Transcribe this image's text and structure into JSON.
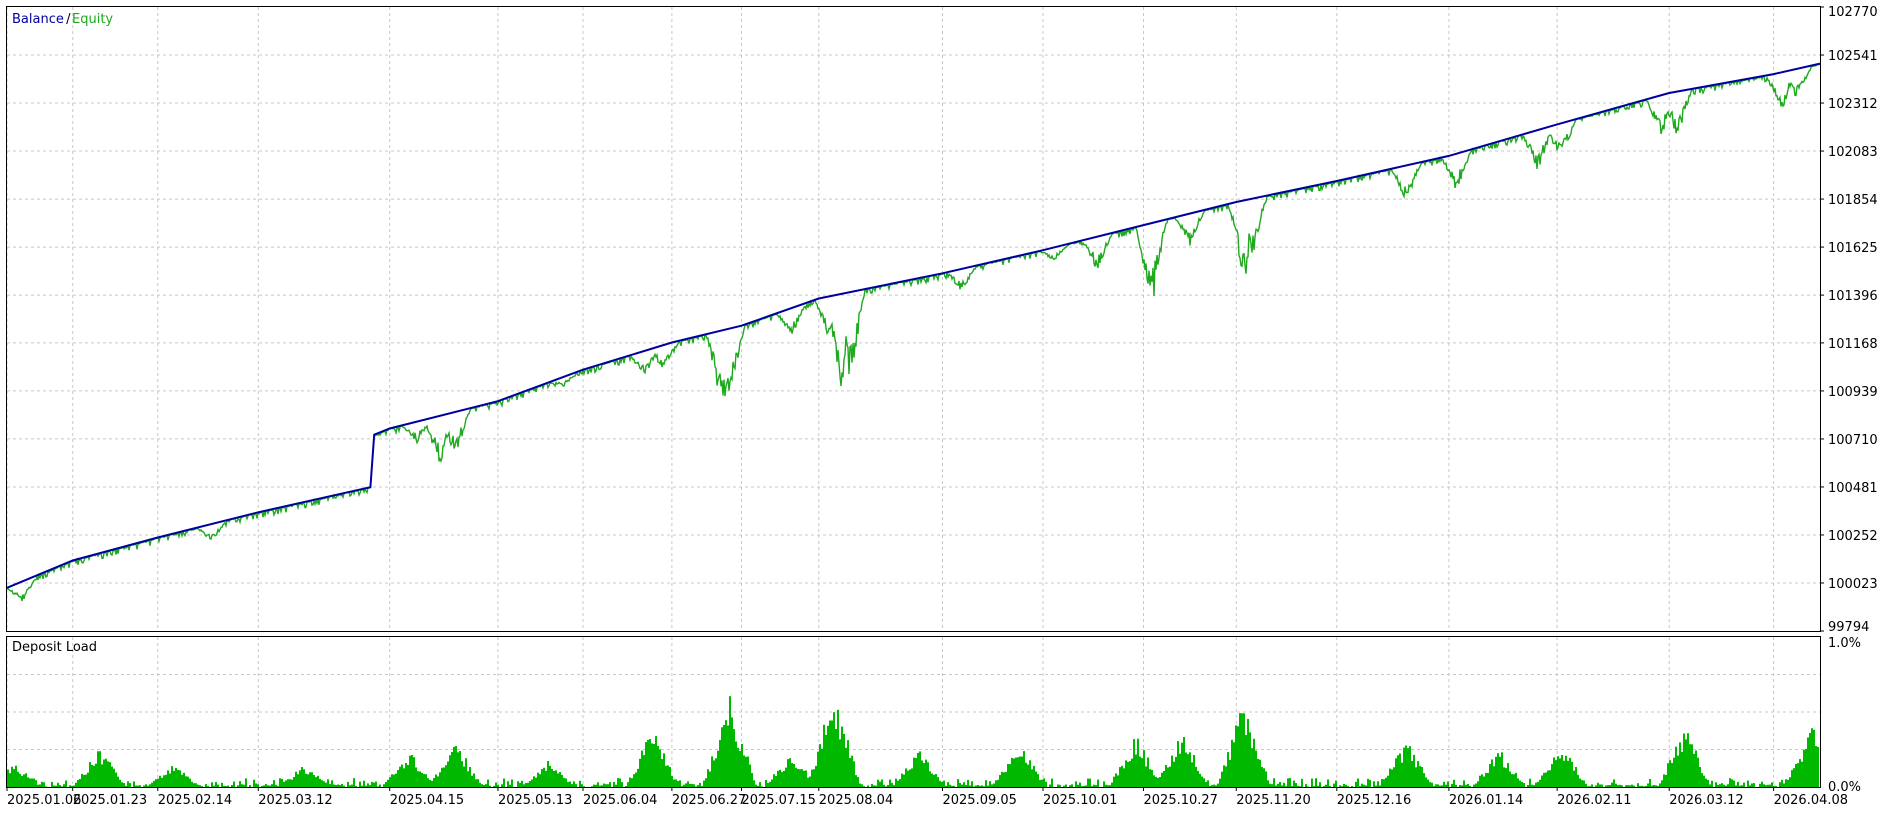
{
  "chart_data": [
    {
      "type": "line",
      "legend": [
        {
          "label": "Balance",
          "color": "#0000a0"
        },
        {
          "label": "Equity",
          "color": "#1fa91f"
        }
      ],
      "legend_separator": " / ",
      "legend_placement": "top-left",
      "grid": true,
      "ylim": [
        99794,
        102770
      ],
      "y_ticks": [
        102770,
        102541,
        102312,
        102083,
        101854,
        101625,
        101396,
        101168,
        100939,
        100710,
        100481,
        100252,
        100023,
        99794
      ],
      "x_ticks": [
        "2025.01.06",
        "2025.01.23",
        "2025.02.14",
        "2025.03.12",
        "2025.04.15",
        "2025.05.13",
        "2025.06.04",
        "2025.06.27",
        "2025.07.15",
        "2025.08.04",
        "2025.09.05",
        "2025.10.01",
        "2025.10.27",
        "2025.11.20",
        "2025.12.16",
        "2026.01.14",
        "2026.02.11",
        "2026.03.12",
        "2026.04.08"
      ],
      "series": [
        {
          "name": "Balance",
          "color": "#0000a0",
          "points": [
            [
              "2025.01.06",
              100000
            ],
            [
              "2025.01.23",
              100130
            ],
            [
              "2025.02.14",
              100240
            ],
            [
              "2025.03.12",
              100360
            ],
            [
              "2025.04.10",
              100480
            ],
            [
              "2025.04.11",
              100730
            ],
            [
              "2025.04.15",
              100760
            ],
            [
              "2025.05.13",
              100890
            ],
            [
              "2025.06.04",
              101040
            ],
            [
              "2025.06.27",
              101170
            ],
            [
              "2025.07.15",
              101250
            ],
            [
              "2025.08.04",
              101380
            ],
            [
              "2025.09.05",
              101500
            ],
            [
              "2025.10.01",
              101610
            ],
            [
              "2025.10.27",
              101730
            ],
            [
              "2025.11.20",
              101840
            ],
            [
              "2025.12.16",
              101940
            ],
            [
              "2026.01.14",
              102060
            ],
            [
              "2026.02.11",
              102210
            ],
            [
              "2026.03.12",
              102360
            ],
            [
              "2026.04.08",
              102450
            ],
            [
              "2026.04.20",
              102500
            ]
          ]
        },
        {
          "name": "Equity",
          "color": "#1fa91f",
          "dips": [
            [
              "2025.01.10",
              99920
            ],
            [
              "2025.02.28",
              100220
            ],
            [
              "2025.04.22",
              100690
            ],
            [
              "2025.04.28",
              100570
            ],
            [
              "2025.05.02",
              100620
            ],
            [
              "2025.05.30",
              100960
            ],
            [
              "2025.06.20",
              101010
            ],
            [
              "2025.06.25",
              101030
            ],
            [
              "2025.07.10",
              100830
            ],
            [
              "2025.07.12",
              100880
            ],
            [
              "2025.07.28",
              101200
            ],
            [
              "2025.08.07",
              101140
            ],
            [
              "2025.08.10",
              100900
            ],
            [
              "2025.08.12",
              100960
            ],
            [
              "2025.09.10",
              101410
            ],
            [
              "2025.10.04",
              101560
            ],
            [
              "2025.10.15",
              101510
            ],
            [
              "2025.10.29",
              101300
            ],
            [
              "2025.11.08",
              101630
            ],
            [
              "2025.11.22",
              101440
            ],
            [
              "2025.11.24",
              101560
            ],
            [
              "2026.01.03",
              101840
            ],
            [
              "2026.01.16",
              101890
            ],
            [
              "2026.02.06",
              101970
            ],
            [
              "2026.02.12",
              102040
            ],
            [
              "2026.03.10",
              102150
            ],
            [
              "2026.03.14",
              102140
            ],
            [
              "2026.04.10",
              102260
            ],
            [
              "2026.04.14",
              102330
            ]
          ]
        }
      ]
    },
    {
      "type": "area",
      "title": "Deposit Load",
      "ylim": [
        0,
        1.0
      ],
      "y_ticks": [
        "1.0%",
        "0.0%"
      ],
      "color": "#00b800",
      "x_ticks": [
        "2025.01.06",
        "2025.01.23",
        "2025.02.14",
        "2025.03.12",
        "2025.04.15",
        "2025.05.13",
        "2025.06.04",
        "2025.06.27",
        "2025.07.15",
        "2025.08.04",
        "2025.09.05",
        "2025.10.01",
        "2025.10.27",
        "2025.11.20",
        "2025.12.16",
        "2026.01.14",
        "2026.02.11",
        "2026.03.12",
        "2026.04.08"
      ],
      "peaks": [
        [
          "2025.01.08",
          0.16
        ],
        [
          "2025.01.30",
          0.27
        ],
        [
          "2025.02.18",
          0.16
        ],
        [
          "2025.03.24",
          0.15
        ],
        [
          "2025.04.20",
          0.25
        ],
        [
          "2025.05.02",
          0.32
        ],
        [
          "2025.05.26",
          0.18
        ],
        [
          "2025.06.22",
          0.4
        ],
        [
          "2025.07.12",
          0.62
        ],
        [
          "2025.07.28",
          0.25
        ],
        [
          "2025.08.08",
          0.67
        ],
        [
          "2025.08.30",
          0.25
        ],
        [
          "2025.09.25",
          0.3
        ],
        [
          "2025.10.25",
          0.36
        ],
        [
          "2025.11.06",
          0.4
        ],
        [
          "2025.11.22",
          0.6
        ],
        [
          "2026.01.03",
          0.32
        ],
        [
          "2026.01.27",
          0.26
        ],
        [
          "2026.02.12",
          0.3
        ],
        [
          "2026.03.16",
          0.42
        ],
        [
          "2026.04.18",
          0.45
        ]
      ]
    }
  ]
}
